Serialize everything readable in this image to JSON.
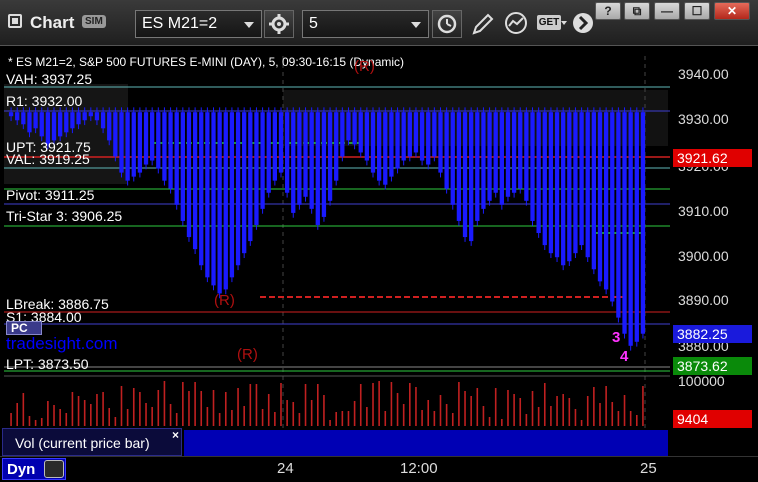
{
  "toolbar": {
    "app_title": "Chart",
    "sim_badge": "SIM",
    "symbol_value": "ES M21=2",
    "interval_value": "5",
    "get_label": "GET"
  },
  "window_controls": {
    "help": "?",
    "restore": "⧉",
    "minimize": "—",
    "maximize": "☐",
    "close": "✕"
  },
  "chart": {
    "header": "* ES M21=2, S&P 500 FUTURES E-MINI (DAY), 5, 09:30-16:15 (Dynamic)",
    "watermark": "tradesight.com",
    "levels": [
      {
        "label": "VAH: 3937.25",
        "color": "#5fb8b8"
      },
      {
        "label": "R1: 3932.00",
        "color": "#3f3fd0"
      },
      {
        "label": "UPT: 3921.75",
        "color": "#2ecc40"
      },
      {
        "label": "VAL: 3919.25",
        "color": "#5fb8b8"
      },
      {
        "label": "Pivot: 3911.25",
        "color": "#2ecc40"
      },
      {
        "label": "Tri-Star 3: 3906.25",
        "color": "#2ecc40"
      },
      {
        "label": "LBreak: 3886.75",
        "color": "#d02020"
      },
      {
        "label": "S1: 3884.00",
        "color": "#3f3fd0"
      },
      {
        "label": "LPT: 3873.50",
        "color": "#2ecc40"
      }
    ],
    "marker_r1": "(R)",
    "marker_r2": "(R)",
    "marker_r3": "(R)",
    "pc_label": "PC",
    "sequence_3": "3",
    "sequence_4": "4"
  },
  "price_axis": {
    "ticks": [
      "3940.00",
      "3930.00",
      "3920.00",
      "3910.00",
      "3900.00",
      "3890.00",
      "3880.00"
    ],
    "upt_box": {
      "value": "3921.62",
      "color": "#e00000"
    },
    "last_box": {
      "value": "3882.25",
      "color": "#1a1adc"
    },
    "lpt_box": {
      "value": "3873.62",
      "color": "#0a8a0a"
    }
  },
  "volume": {
    "label": "Vol (current price bar)",
    "close_glyph": "×",
    "axis_top": "100000",
    "current_box": {
      "value": "9404",
      "color": "#e00000"
    }
  },
  "time_axis": {
    "dyn_label": "Dyn",
    "ticks": [
      "24",
      "12:00",
      "25"
    ]
  },
  "chart_data": {
    "type": "candlestick",
    "y_range": [
      3872,
      3944
    ],
    "y_ticks": [
      3940,
      3930,
      3920,
      3910,
      3900,
      3890,
      3880
    ],
    "x_ticks": [
      "24",
      "12:00",
      "25"
    ],
    "closes": [
      3936,
      3935,
      3934,
      3932,
      3933,
      3931,
      3929,
      3930,
      3931,
      3932,
      3933,
      3934,
      3935,
      3936,
      3935,
      3933,
      3930,
      3926,
      3922,
      3920,
      3921,
      3922,
      3924,
      3925,
      3923,
      3920,
      3918,
      3914,
      3910,
      3906,
      3903,
      3899,
      3896,
      3894,
      3892,
      3893,
      3896,
      3899,
      3902,
      3905,
      3909,
      3913,
      3917,
      3920,
      3922,
      3917,
      3912,
      3914,
      3916,
      3913,
      3909,
      3911,
      3915,
      3920,
      3926,
      3930,
      3929,
      3927,
      3925,
      3922,
      3920,
      3919,
      3921,
      3923,
      3925,
      3926,
      3927,
      3925,
      3924,
      3926,
      3922,
      3918,
      3914,
      3910,
      3906,
      3905,
      3910,
      3913,
      3915,
      3917,
      3914,
      3916,
      3917,
      3918,
      3915,
      3910,
      3907,
      3904,
      3902,
      3901,
      3899,
      3900,
      3902,
      3904,
      3901,
      3898,
      3895,
      3893,
      3890,
      3886,
      3882,
      3879,
      3880,
      3882
    ],
    "volume_axis_max": 100000,
    "current_volume": 9404
  }
}
